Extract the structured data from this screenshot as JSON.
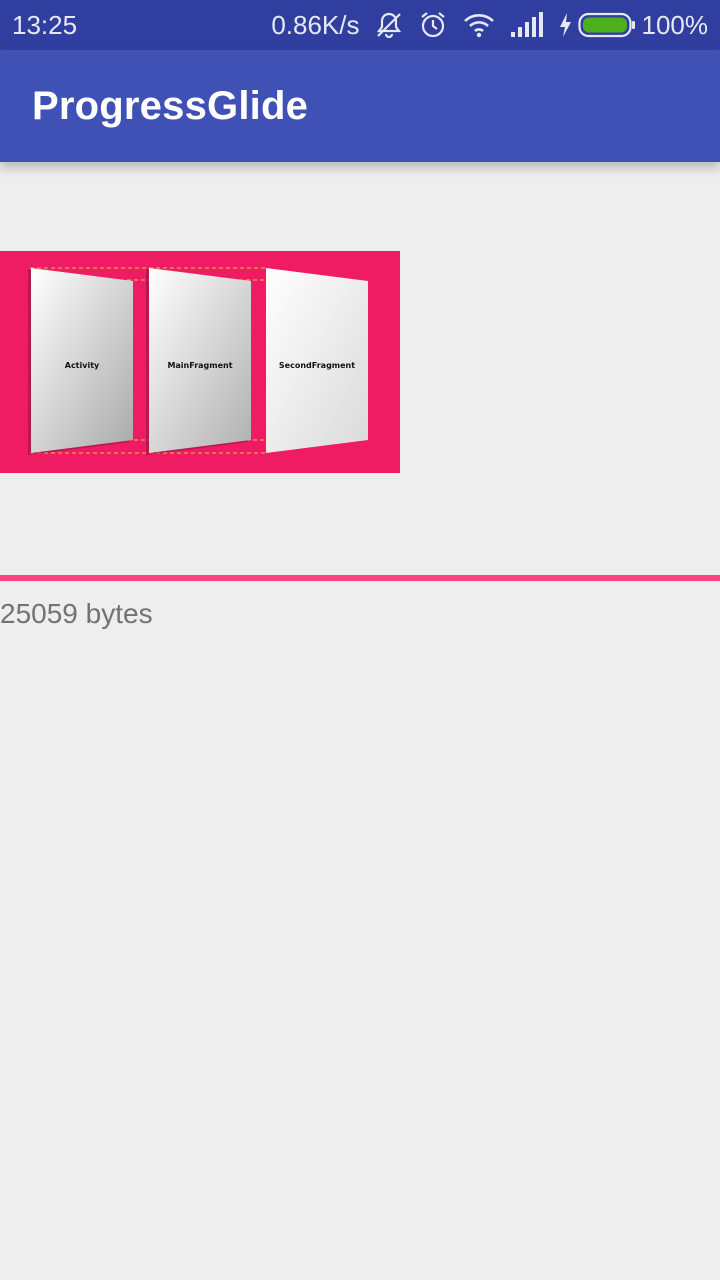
{
  "status_bar": {
    "time": "13:25",
    "net_speed": "0.86K/s",
    "battery_percent": "100%",
    "icons": [
      "mute-icon",
      "alarm-icon",
      "wifi-icon",
      "signal-icon",
      "charging-icon",
      "battery-icon"
    ]
  },
  "app_bar": {
    "title": "ProgressGlide",
    "color": "#3f51b5"
  },
  "image": {
    "panels": [
      "Activity",
      "MainFragment",
      "SecondFragment"
    ],
    "background_color": "#f01c63"
  },
  "progress": {
    "fraction": 1.0,
    "color": "#ff4081"
  },
  "bytes_label": "25059 bytes"
}
